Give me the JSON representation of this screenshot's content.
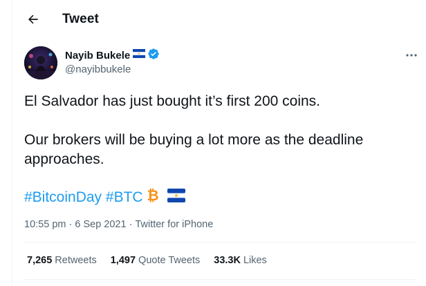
{
  "header": {
    "title": "Tweet"
  },
  "author": {
    "name": "Nayib Bukele",
    "handle": "@nayibbukele"
  },
  "tweet": {
    "paragraphs": [
      "El Salvador has just bought it’s first 200 coins.",
      "Our brokers will be buying a lot more as the deadline approaches."
    ],
    "hashtags": [
      "#BitcoinDay",
      "#BTC"
    ]
  },
  "meta": {
    "time": "10:55 pm",
    "sep1": " · ",
    "date": "6 Sep 2021",
    "sep2": " · ",
    "source": "Twitter for iPhone"
  },
  "stats": {
    "retweets": {
      "count": "7,265",
      "label": "Retweets"
    },
    "quotes": {
      "count": "1,497",
      "label": "Quote Tweets"
    },
    "likes": {
      "count": "33.3K",
      "label": "Likes"
    }
  },
  "icons": {
    "back": "arrow-left-icon",
    "verified": "verified-badge-icon",
    "flag": "el-salvador-flag-icon",
    "bitcoin": "bitcoin-icon",
    "more": "more-horizontal-icon"
  },
  "colors": {
    "link": "#1d9bf0",
    "secondary_text": "#536471",
    "bitcoin_orange": "#f7931a",
    "flag_blue": "#0f47af"
  }
}
